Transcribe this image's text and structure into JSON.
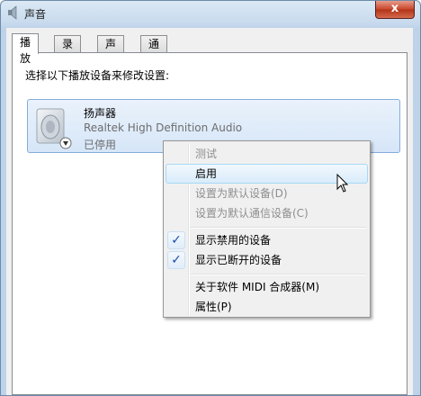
{
  "window": {
    "title": "声音",
    "close_glyph": "x"
  },
  "tabs": [
    {
      "label": "播放",
      "active": true
    },
    {
      "label": "录制",
      "active": false
    },
    {
      "label": "声音",
      "active": false
    },
    {
      "label": "通信",
      "active": false
    }
  ],
  "playback": {
    "instruction": "选择以下播放设备来修改设置:",
    "device": {
      "name": "扬声器",
      "driver": "Realtek High Definition Audio",
      "status": "已停用",
      "icon": "speaker-icon"
    }
  },
  "context_menu": {
    "items": [
      {
        "label": "测试",
        "enabled": false
      },
      {
        "label": "启用",
        "enabled": true,
        "highlighted": true
      },
      {
        "label": "设置为默认设备(D)",
        "enabled": false
      },
      {
        "label": "设置为默认通信设备(C)",
        "enabled": false
      },
      {
        "label": "显示禁用的设备",
        "enabled": true,
        "checked": true
      },
      {
        "label": "显示已断开的设备",
        "enabled": true,
        "checked": true
      },
      {
        "label": "关于软件 MIDI 合成器(M)",
        "enabled": true
      },
      {
        "label": "属性(P)",
        "enabled": true
      }
    ],
    "check_glyph": "✓"
  },
  "colors": {
    "title_gradient_top": "#dbe9f5",
    "close_button": "#c8452a",
    "selection_border": "#84acdd",
    "disabled_text": "#8e8e8e",
    "check": "#1d4fa5"
  }
}
